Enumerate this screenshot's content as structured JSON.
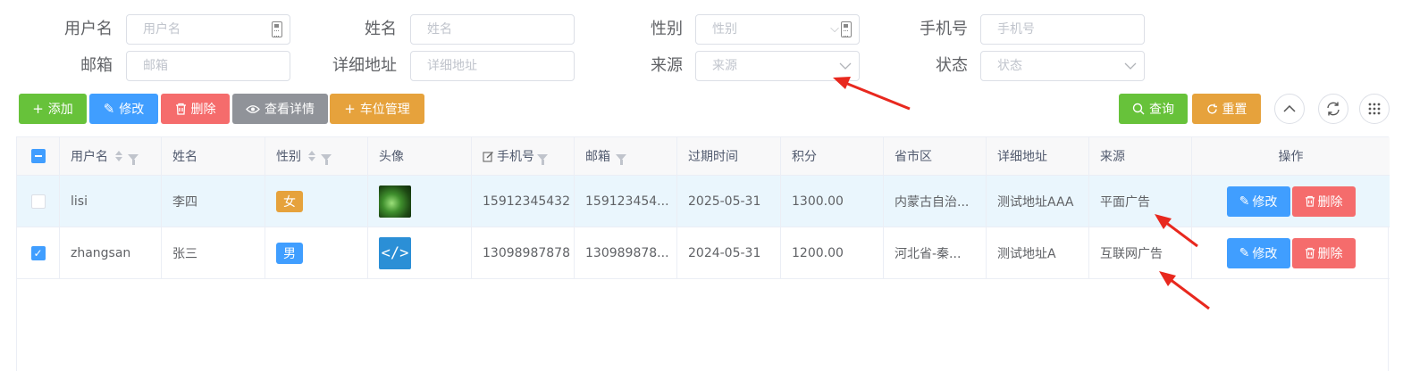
{
  "search_form": {
    "row1": [
      {
        "label": "用户名",
        "placeholder": "用户名"
      },
      {
        "label": "姓名",
        "placeholder": "姓名"
      },
      {
        "label": "性别",
        "placeholder": "性别"
      },
      {
        "label": "手机号",
        "placeholder": "手机号"
      }
    ],
    "row2": [
      {
        "label": "邮箱",
        "placeholder": "邮箱"
      },
      {
        "label": "详细地址",
        "placeholder": "详细地址"
      },
      {
        "label": "来源",
        "placeholder": "来源"
      },
      {
        "label": "状态",
        "placeholder": "状态"
      }
    ]
  },
  "toolbar": {
    "add": "添加",
    "edit": "修改",
    "delete": "删除",
    "view_detail": "查看详情",
    "parking": "车位管理",
    "query": "查询",
    "reset": "重置"
  },
  "table": {
    "columns": [
      "用户名",
      "姓名",
      "性别",
      "头像",
      "手机号",
      "邮箱",
      "过期时间",
      "积分",
      "省市区",
      "详细地址",
      "来源",
      "操作"
    ],
    "rows": [
      {
        "checked": false,
        "username": "lisi",
        "name": "李四",
        "gender": "女",
        "avatar": "green-photo-avatar",
        "phone": "15912345432",
        "email": "159123454...",
        "expire": "2025-05-31",
        "points": "1300.00",
        "region": "内蒙古自治...",
        "address": "测试地址AAA",
        "source": "平面广告",
        "edit": "修改",
        "delete": "删除"
      },
      {
        "checked": true,
        "username": "zhangsan",
        "name": "张三",
        "gender": "男",
        "avatar": "code-avatar",
        "phone": "13098987878",
        "email": "130989878...",
        "expire": "2024-05-31",
        "points": "1200.00",
        "region": "河北省-秦...",
        "address": "测试地址A",
        "source": "互联网广告",
        "edit": "修改",
        "delete": "删除"
      }
    ]
  },
  "colors": {
    "primary": "#409eff",
    "success": "#67c23a",
    "danger": "#f56c6c",
    "info": "#909399",
    "warning": "#e6a23c",
    "annotation_arrow": "#e8281e"
  }
}
